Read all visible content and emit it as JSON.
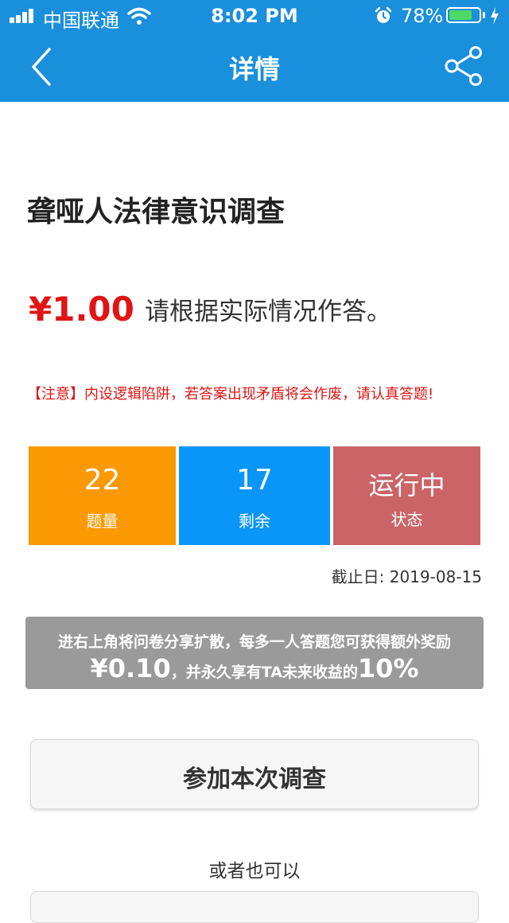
{
  "status_bar": {
    "carrier": "中国联通",
    "time": "8:02 PM",
    "battery_percent": "78%",
    "battery_level": 0.78,
    "icons": [
      "signal-icon",
      "wifi-icon",
      "alarm-icon",
      "battery-icon",
      "charging-bolt-icon"
    ]
  },
  "nav": {
    "title": "详情",
    "back_icon": "chevron-left-icon",
    "share_icon": "share-icon"
  },
  "survey": {
    "title": "聋哑人法律意识调查",
    "price": "¥1.00",
    "price_note": "请根据实际情况作答。",
    "warning": "【注意】内设逻辑陷阱，若答案出现矛盾将会作废，请认真答题!"
  },
  "stats": {
    "questions_value": "22",
    "questions_label": "题量",
    "remaining_value": "17",
    "remaining_label": "剩余",
    "status_value": "运行中",
    "status_label": "状态"
  },
  "deadline": "截止日: 2019-08-15",
  "promo": {
    "line1": "进右上角将问卷分享扩散，每多一人答题您可获得额外奖励",
    "reward": "¥0.10",
    "middle": "，并永久享有TA未来收益的",
    "percent": "10%"
  },
  "actions": {
    "join_label": "参加本次调查",
    "or_text": "或者也可以"
  },
  "colors": {
    "header": "#1a8fdc",
    "price_red": "#e01414",
    "questions_orange": "#fb9904",
    "remaining_blue": "#0996f8",
    "status_red": "#cb6467",
    "promo_gray": "#9a9a9a"
  }
}
